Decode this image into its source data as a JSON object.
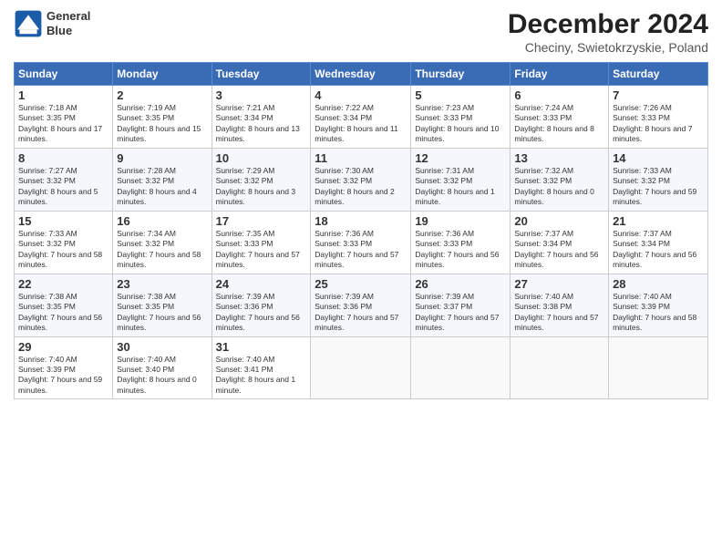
{
  "header": {
    "logo_line1": "General",
    "logo_line2": "Blue",
    "title": "December 2024",
    "subtitle": "Checiny, Swietokrzyskie, Poland"
  },
  "columns": [
    "Sunday",
    "Monday",
    "Tuesday",
    "Wednesday",
    "Thursday",
    "Friday",
    "Saturday"
  ],
  "rows": [
    [
      {
        "day": "1",
        "info": "Sunrise: 7:18 AM\nSunset: 3:35 PM\nDaylight: 8 hours and 17 minutes."
      },
      {
        "day": "2",
        "info": "Sunrise: 7:19 AM\nSunset: 3:35 PM\nDaylight: 8 hours and 15 minutes."
      },
      {
        "day": "3",
        "info": "Sunrise: 7:21 AM\nSunset: 3:34 PM\nDaylight: 8 hours and 13 minutes."
      },
      {
        "day": "4",
        "info": "Sunrise: 7:22 AM\nSunset: 3:34 PM\nDaylight: 8 hours and 11 minutes."
      },
      {
        "day": "5",
        "info": "Sunrise: 7:23 AM\nSunset: 3:33 PM\nDaylight: 8 hours and 10 minutes."
      },
      {
        "day": "6",
        "info": "Sunrise: 7:24 AM\nSunset: 3:33 PM\nDaylight: 8 hours and 8 minutes."
      },
      {
        "day": "7",
        "info": "Sunrise: 7:26 AM\nSunset: 3:33 PM\nDaylight: 8 hours and 7 minutes."
      }
    ],
    [
      {
        "day": "8",
        "info": "Sunrise: 7:27 AM\nSunset: 3:32 PM\nDaylight: 8 hours and 5 minutes."
      },
      {
        "day": "9",
        "info": "Sunrise: 7:28 AM\nSunset: 3:32 PM\nDaylight: 8 hours and 4 minutes."
      },
      {
        "day": "10",
        "info": "Sunrise: 7:29 AM\nSunset: 3:32 PM\nDaylight: 8 hours and 3 minutes."
      },
      {
        "day": "11",
        "info": "Sunrise: 7:30 AM\nSunset: 3:32 PM\nDaylight: 8 hours and 2 minutes."
      },
      {
        "day": "12",
        "info": "Sunrise: 7:31 AM\nSunset: 3:32 PM\nDaylight: 8 hours and 1 minute."
      },
      {
        "day": "13",
        "info": "Sunrise: 7:32 AM\nSunset: 3:32 PM\nDaylight: 8 hours and 0 minutes."
      },
      {
        "day": "14",
        "info": "Sunrise: 7:33 AM\nSunset: 3:32 PM\nDaylight: 7 hours and 59 minutes."
      }
    ],
    [
      {
        "day": "15",
        "info": "Sunrise: 7:33 AM\nSunset: 3:32 PM\nDaylight: 7 hours and 58 minutes."
      },
      {
        "day": "16",
        "info": "Sunrise: 7:34 AM\nSunset: 3:32 PM\nDaylight: 7 hours and 58 minutes."
      },
      {
        "day": "17",
        "info": "Sunrise: 7:35 AM\nSunset: 3:33 PM\nDaylight: 7 hours and 57 minutes."
      },
      {
        "day": "18",
        "info": "Sunrise: 7:36 AM\nSunset: 3:33 PM\nDaylight: 7 hours and 57 minutes."
      },
      {
        "day": "19",
        "info": "Sunrise: 7:36 AM\nSunset: 3:33 PM\nDaylight: 7 hours and 56 minutes."
      },
      {
        "day": "20",
        "info": "Sunrise: 7:37 AM\nSunset: 3:34 PM\nDaylight: 7 hours and 56 minutes."
      },
      {
        "day": "21",
        "info": "Sunrise: 7:37 AM\nSunset: 3:34 PM\nDaylight: 7 hours and 56 minutes."
      }
    ],
    [
      {
        "day": "22",
        "info": "Sunrise: 7:38 AM\nSunset: 3:35 PM\nDaylight: 7 hours and 56 minutes."
      },
      {
        "day": "23",
        "info": "Sunrise: 7:38 AM\nSunset: 3:35 PM\nDaylight: 7 hours and 56 minutes."
      },
      {
        "day": "24",
        "info": "Sunrise: 7:39 AM\nSunset: 3:36 PM\nDaylight: 7 hours and 56 minutes."
      },
      {
        "day": "25",
        "info": "Sunrise: 7:39 AM\nSunset: 3:36 PM\nDaylight: 7 hours and 57 minutes."
      },
      {
        "day": "26",
        "info": "Sunrise: 7:39 AM\nSunset: 3:37 PM\nDaylight: 7 hours and 57 minutes."
      },
      {
        "day": "27",
        "info": "Sunrise: 7:40 AM\nSunset: 3:38 PM\nDaylight: 7 hours and 57 minutes."
      },
      {
        "day": "28",
        "info": "Sunrise: 7:40 AM\nSunset: 3:39 PM\nDaylight: 7 hours and 58 minutes."
      }
    ],
    [
      {
        "day": "29",
        "info": "Sunrise: 7:40 AM\nSunset: 3:39 PM\nDaylight: 7 hours and 59 minutes."
      },
      {
        "day": "30",
        "info": "Sunrise: 7:40 AM\nSunset: 3:40 PM\nDaylight: 8 hours and 0 minutes."
      },
      {
        "day": "31",
        "info": "Sunrise: 7:40 AM\nSunset: 3:41 PM\nDaylight: 8 hours and 1 minute."
      },
      {
        "day": "",
        "info": ""
      },
      {
        "day": "",
        "info": ""
      },
      {
        "day": "",
        "info": ""
      },
      {
        "day": "",
        "info": ""
      }
    ]
  ]
}
